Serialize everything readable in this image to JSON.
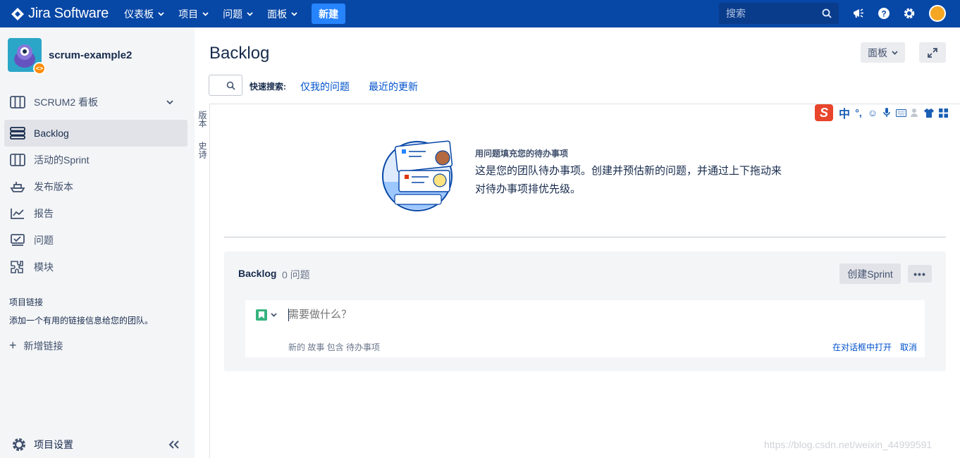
{
  "topnav": {
    "logo": "Jira Software",
    "items": [
      {
        "label": "仪表板"
      },
      {
        "label": "项目"
      },
      {
        "label": "问题"
      },
      {
        "label": "面板"
      }
    ],
    "create_label": "新建",
    "search_placeholder": "搜索",
    "icons": [
      "notification-icon",
      "help-icon",
      "settings-icon",
      "user-avatar"
    ]
  },
  "sidebar": {
    "project_name": "scrum-example2",
    "items": [
      {
        "label": "SCRUM2 看板",
        "icon": "board-icon"
      },
      {
        "label": "Backlog",
        "icon": "backlog-icon"
      },
      {
        "label": "活动的Sprint",
        "icon": "sprint-icon"
      },
      {
        "label": "发布版本",
        "icon": "release-icon"
      },
      {
        "label": "报告",
        "icon": "reports-icon"
      },
      {
        "label": "问题",
        "icon": "issues-icon"
      },
      {
        "label": "模块",
        "icon": "components-icon"
      }
    ],
    "links_title": "项目链接",
    "links_desc": "添加一个有用的链接信息给您的团队。",
    "add_link": "新增链接",
    "settings": "项目设置"
  },
  "vtabs": [
    "版本",
    "史诗"
  ],
  "main": {
    "title": "Backlog",
    "board_button": "面板",
    "quick_search_label": "快速搜索:",
    "quick_links": [
      "仅我的问题",
      "最近的更新"
    ],
    "ime_label": "中",
    "empty_title": "用问题填充您的待办事项",
    "empty_desc": "这是您的团队待办事项。创建并预估新的问题，并通过上下拖动来对待办事项排优先级。",
    "backlog_title": "Backlog",
    "backlog_count": "0 问题",
    "create_sprint": "创建Sprint",
    "create_placeholder": "需要做什么？",
    "create_hint": "新的 故事 包含 待办事项",
    "open_dialog": "在对话框中打开",
    "cancel": "取消"
  },
  "watermark": "https://blog.csdn.net/weixin_44999591"
}
